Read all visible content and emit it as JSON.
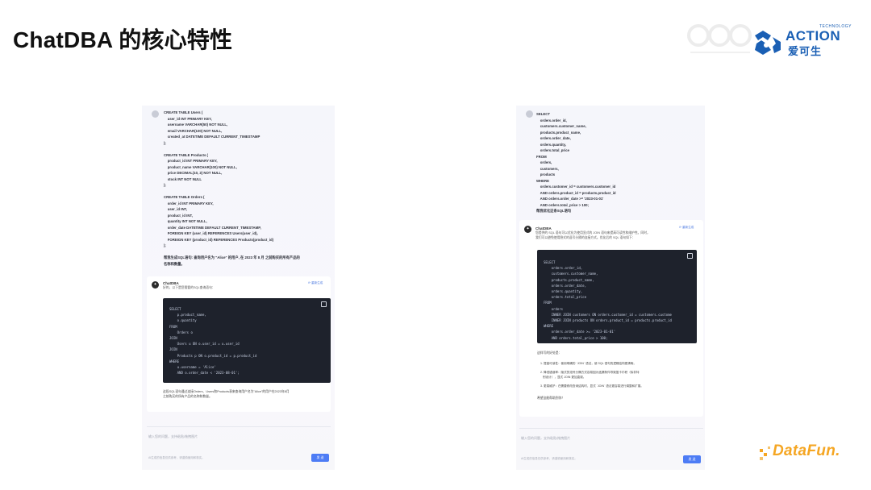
{
  "slide": {
    "title": "ChatDBA 的核心特性"
  },
  "brand": {
    "action_word": "ACTION",
    "action_tech": "TECHNOLOGY",
    "action_cn": "爱可生",
    "datafun": "DataFun.",
    "action_color": "#1a5fb4",
    "datafun_color": "#f5a623"
  },
  "left_chat": {
    "user_prompt": "CREATE TABLE Users (\n    user_id INT PRIMARY KEY,\n    username VARCHAR(50) NOT NULL,\n    email VARCHAR(100) NOT NULL,\n    created_at DATETIME DEFAULT CURRENT_TIMESTAMP\n);\n\nCREATE TABLE Products (\n    product_id INT PRIMARY KEY,\n    product_name VARCHAR(100) NOT NULL,\n    price DECIMAL(10, 2) NOT NULL,\n    stock INT NOT NULL\n);\n\nCREATE TABLE Orders (\n    order_id INT PRIMARY KEY,\n    user_id INT,\n    product_id INT,\n    quantity INT NOT NULL,\n    order_date DATETIME DEFAULT CURRENT_TIMESTAMP,\n    FOREIGN KEY (user_id) REFERENCES Users(user_id),\n    FOREIGN KEY (product_id) REFERENCES Products(product_id)\n);\n\n帮我生成SQL语句: 查询用户名为 \"Alice\" 的用户, 在 2023 年 8 月 之前购买的所有产品的\n名称和数量。",
    "bot_name": "ChatDBA",
    "bot_intro": "好的，以下是您需要的SQL查询语句：",
    "regenerate": "重新生成",
    "code": "SELECT\n    p.product_name,\n    o.quantity\nFROM\n    Orders o\nJOIN\n    Users u ON o.user_id = u.user_id\nJOIN\n    Products p ON o.product_id = p.product_id\nWHERE\n    u.username = 'Alice'\n    AND o.order_date < '2023-08-01';",
    "explanation": "这段SQL语句通过连接Orders、Users和Products表来查询用户名为\"Alice\"的用户在2023年8月\n之前购买的所有产品的名称和数量。",
    "input_placeholder": "输入您的问题，支持粘贴/拖拽图片",
    "disclaimer": "AI生成的信息仅供参考，请谨慎使用和核实。",
    "send_label": "发 送"
  },
  "right_chat": {
    "user_prompt": "SELECT\n    orders.order_id,\n    customers.customer_name,\n    products.product_name,\n    orders.order_date,\n    orders.quantity,\n    orders.total_price\nFROM\n    orders,\n    customers,\n    products\nWHERE\n    orders.customer_id = customers.customer_id\n    AND orders.product_id = products.product_id\n    AND orders.order_date >= '2023-01-01'\n    AND orders.total_price > 100;\n帮我优化这条SQL语句",
    "bot_name": "ChatDBA",
    "bot_intro": "您提供的 SQL 语句可以优化为使用显式的 JOIN 语句来提高可读性和维护性。同时，\n我们可以避免使用隐式的逗号分隔的连接方式。优化后的 SQL 语句如下：",
    "regenerate": "重新生成",
    "code": "SELECT\n    orders.order_id,\n    customers.customer_name,\n    products.product_name,\n    orders.order_date,\n    orders.quantity,\n    orders.total_price\nFROM\n    orders\n    INNER JOIN customers ON orders.customer_id = customers.custome\n    INNER JOIN products ON orders.product_id = products.product_id\nWHERE\n    orders.order_date >= '2023-01-01'\n    AND orders.total_price > 100;",
    "points_intro": "这样写的好处是：",
    "points": [
      "1. 提高可读性：使用明确的 `JOIN` 语法，使 SQL 语句的逻辑结构更清晰。",
      "2. 降低错误率：隐式的逗号分隔方式容易因为遗漏条件导致笛卡尔积（除非特\n   别设计），显式 JOIN 更加直观。",
      "3. 更易维护：在需要修改查询结构时，显式 `JOIN` 语法更容易进行调整和扩展。"
    ],
    "closing": "希望这能帮助到你！",
    "input_placeholder": "输入您的问题，支持粘贴/拖拽图片",
    "disclaimer": "AI生成的信息仅供参考，请谨慎使用和核实。",
    "send_label": "发 送"
  }
}
